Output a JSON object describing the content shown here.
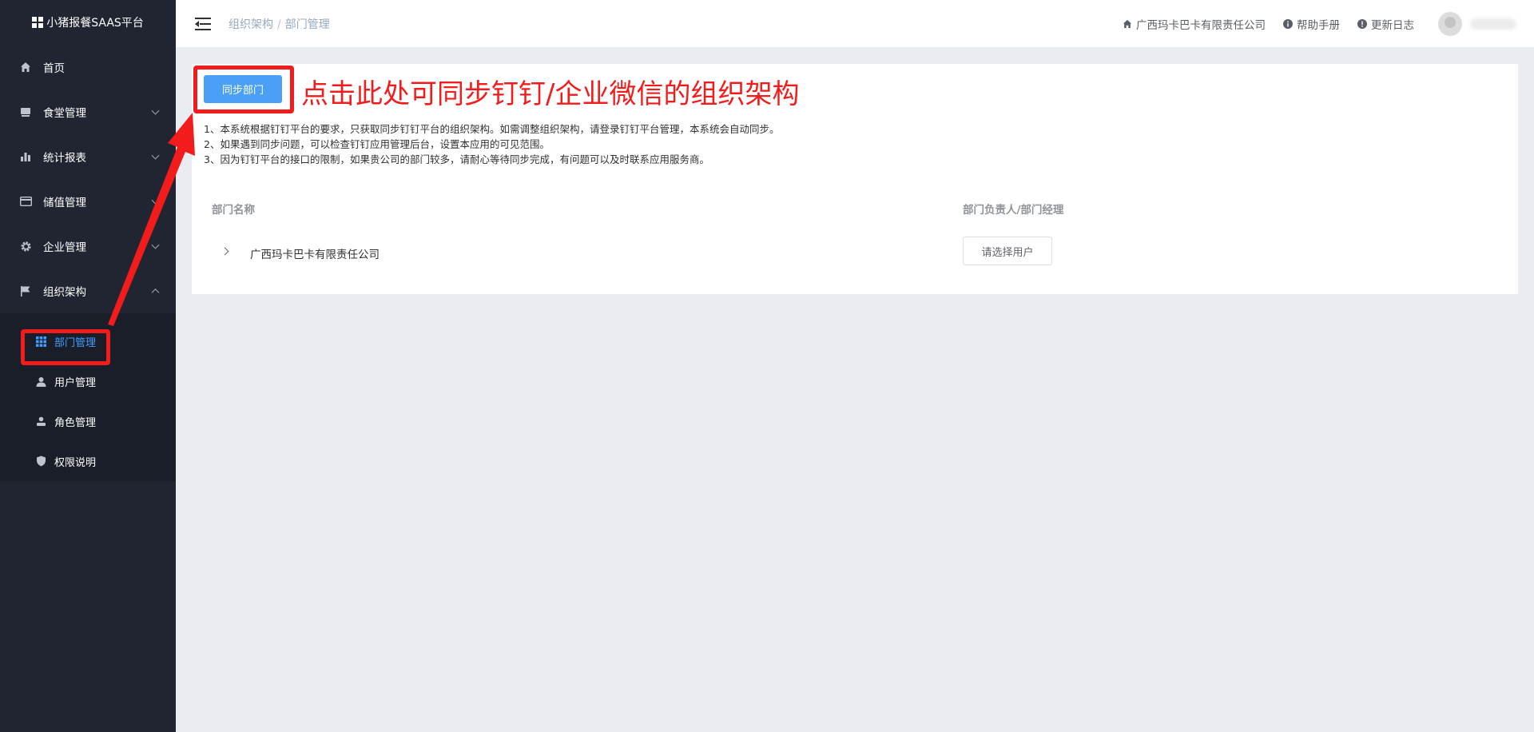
{
  "app": {
    "title": "小猪报餐SAAS平台"
  },
  "sidebar": {
    "items": [
      {
        "label": "首页",
        "icon": "home-icon",
        "has_children": false
      },
      {
        "label": "食堂管理",
        "icon": "canteen-icon",
        "has_children": true
      },
      {
        "label": "统计报表",
        "icon": "chart-icon",
        "has_children": true
      },
      {
        "label": "储值管理",
        "icon": "card-icon",
        "has_children": true
      },
      {
        "label": "企业管理",
        "icon": "gear-icon",
        "has_children": true
      },
      {
        "label": "组织架构",
        "icon": "flag-icon",
        "has_children": true,
        "expanded": true
      }
    ],
    "submenu": [
      {
        "label": "部门管理",
        "icon": "grid-icon",
        "active": true
      },
      {
        "label": "用户管理",
        "icon": "user-icon",
        "active": false
      },
      {
        "label": "角色管理",
        "icon": "role-icon",
        "active": false
      },
      {
        "label": "权限说明",
        "icon": "shield-icon",
        "active": false
      }
    ]
  },
  "header": {
    "breadcrumb": [
      "组织架构",
      "部门管理"
    ],
    "breadcrumb_sep": "/",
    "company": "广西玛卡巴卡有限责任公司",
    "help": "帮助手册",
    "changelog": "更新日志"
  },
  "main": {
    "sync_button": "同步部门",
    "annotation": "点击此处可同步钉钉/企业微信的组织架构",
    "notes": [
      "1、本系统根据钉钉平台的要求，只获取同步钉钉平台的组织架构。如需调整组织架构，请登录钉钉平台管理，本系统会自动同步。",
      "2、如果遇到同步问题，可以检查钉钉应用管理后台，设置本应用的可见范围。",
      "3、因为钉钉平台的接口的限制，如果贵公司的部门较多，请耐心等待同步完成，有问题可以及时联系应用服务商。"
    ],
    "table": {
      "columns": [
        "部门名称",
        "部门负责人/部门经理"
      ],
      "rows": [
        {
          "name": "广西玛卡巴卡有限责任公司",
          "action": "请选择用户"
        }
      ]
    }
  },
  "colors": {
    "sidebar_bg": "#202531",
    "accent": "#409eff",
    "button_primary": "#4aa0f7",
    "annotation_red": "#f21c1c",
    "page_bg": "#e9edf1"
  }
}
